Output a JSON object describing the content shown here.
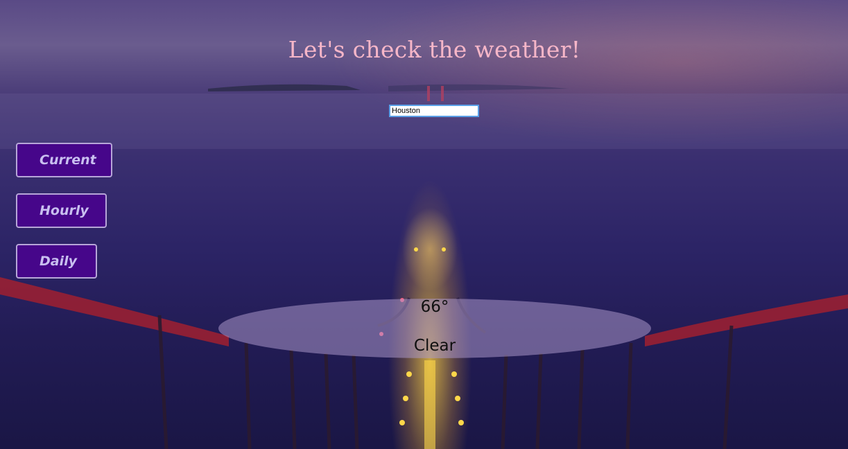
{
  "page": {
    "title": "Let's check the weather!"
  },
  "search": {
    "value": "Houston"
  },
  "nav": {
    "current_label": "Current",
    "hourly_label": "Hourly",
    "daily_label": "Daily"
  },
  "weather": {
    "temperature": "66°",
    "condition": "Clear"
  },
  "colors": {
    "title": "#f6b6c8",
    "button_bg": "#46068a",
    "button_text": "#c9bff0",
    "button_border": "#b7a6d8",
    "input_border": "#5aa0e8"
  }
}
